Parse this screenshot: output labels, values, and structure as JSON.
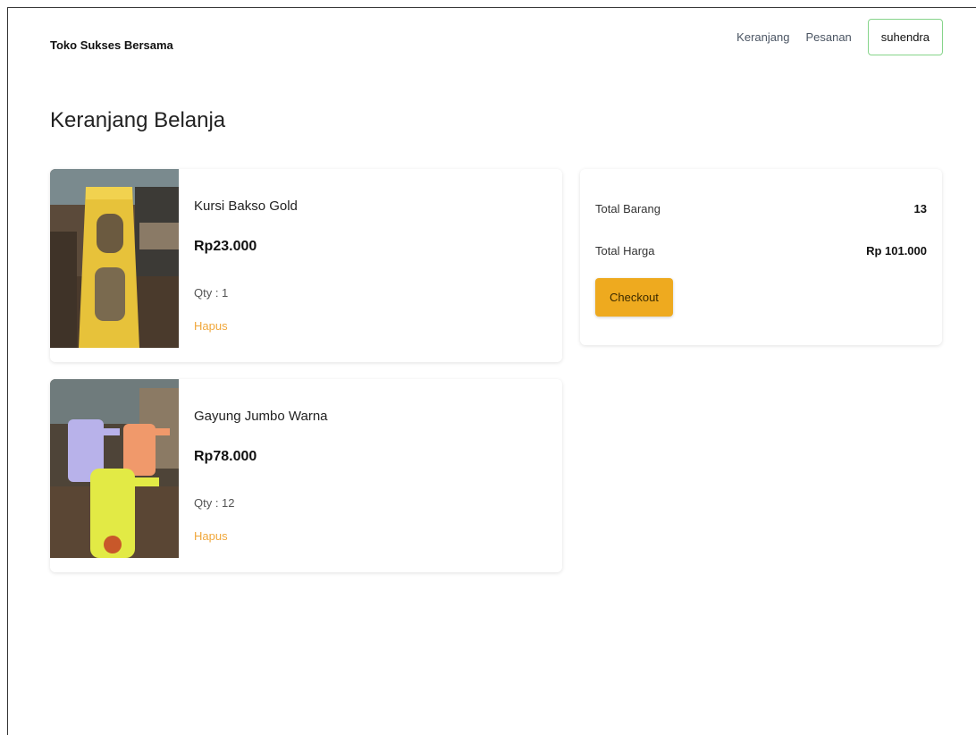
{
  "header": {
    "brand": "Toko Sukses Bersama",
    "nav": [
      "Keranjang",
      "Pesanan"
    ],
    "user": "suhendra"
  },
  "page": {
    "title": "Keranjang Belanja"
  },
  "cart": {
    "items": [
      {
        "name": "Kursi Bakso Gold",
        "price": "Rp23.000",
        "qty": "Qty : 1",
        "remove_label": "Hapus",
        "image": "yellow-plastic-stool-photo"
      },
      {
        "name": "Gayung Jumbo Warna",
        "price": "Rp78.000",
        "qty": "Qty : 12",
        "remove_label": "Hapus",
        "image": "colorful-water-dippers-photo"
      }
    ]
  },
  "summary": {
    "total_items_label": "Total Barang",
    "total_items_value": "13",
    "total_price_label": "Total Harga",
    "total_price_value": "Rp 101.000",
    "checkout_label": "Checkout"
  },
  "colors": {
    "accent": "#eeaa1f",
    "remove_link": "#f0a73a",
    "user_border": "#86d48a"
  }
}
